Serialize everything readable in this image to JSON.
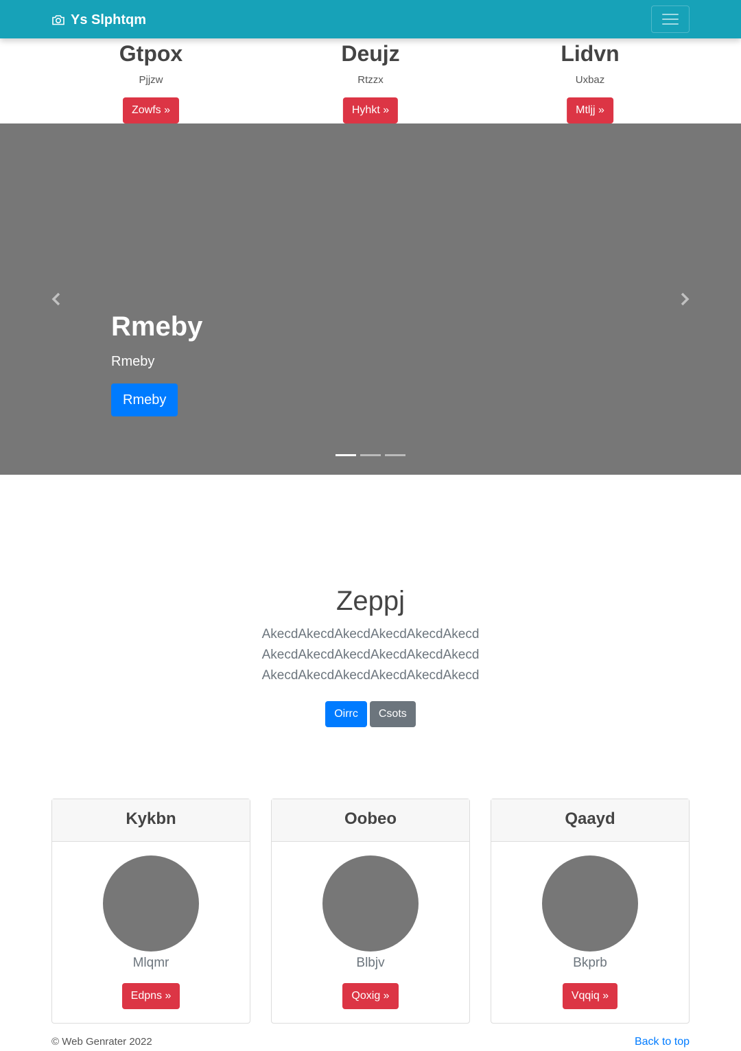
{
  "navbar": {
    "brand": "Ys Slphtqm",
    "brand_icon": "camera-icon",
    "toggler_icon": "hamburger-icon",
    "background": "#17a2b8"
  },
  "features": [
    {
      "title": "Gtpox",
      "text": "Pjjzw",
      "button": "Zowfs »"
    },
    {
      "title": "Deujz",
      "text": "Rtzzx",
      "button": "Hyhkt »"
    },
    {
      "title": "Lidvn",
      "text": "Uxbaz",
      "button": "Mtljj »"
    }
  ],
  "carousel": {
    "title": "Rmeby",
    "subtitle": "Rmeby",
    "button": "Rmeby",
    "prev_icon": "chevron-left-icon",
    "next_icon": "chevron-right-icon",
    "slides": 3,
    "active_slide": 1
  },
  "jumbotron": {
    "title": "Zeppj",
    "lead": "AkecdAkecdAkecdAkecdAkecdAkecd AkecdAkecdAkecdAkecdAkecdAkecd AkecdAkecdAkecdAkecdAkecdAkecd",
    "primary_button": "Oirrc",
    "secondary_button": "Csots"
  },
  "cards": [
    {
      "header": "Kykbn",
      "name": "Mlqmr",
      "button": "Edpns »"
    },
    {
      "header": "Oobeo",
      "name": "Blbjv",
      "button": "Qoxig »"
    },
    {
      "header": "Qaayd",
      "name": "Bkprb",
      "button": "Vqqiq »"
    }
  ],
  "footer": {
    "copyright": "© Web Genrater 2022",
    "back_to_top": "Back to top"
  },
  "colors": {
    "danger": "#dc3545",
    "primary": "#007bff",
    "secondary": "#6c757d",
    "placeholder_gray": "#777777"
  }
}
